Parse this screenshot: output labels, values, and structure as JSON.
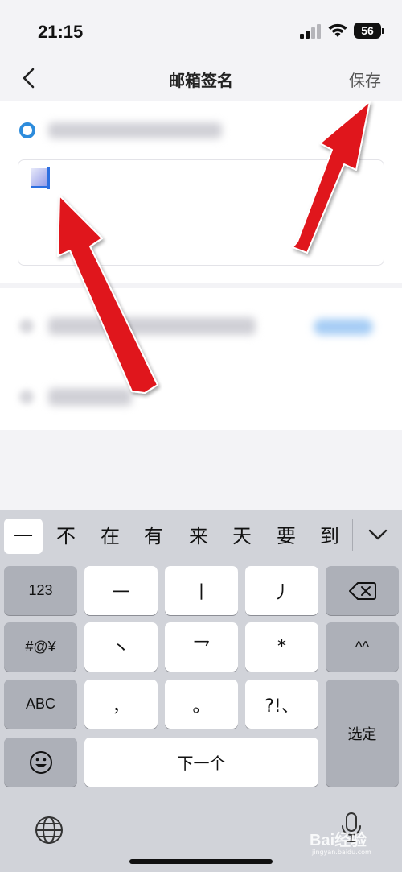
{
  "status_bar": {
    "time": "21:15",
    "battery": "56"
  },
  "nav": {
    "title": "邮箱签名",
    "save_label": "保存"
  },
  "keyboard": {
    "candidates": [
      "一",
      "不",
      "在",
      "有",
      "来",
      "天",
      "要",
      "到"
    ],
    "keys": {
      "num": "123",
      "sym": "#@¥",
      "abc": "ABC",
      "heng": "一",
      "shu": "丨",
      "pie": "丿",
      "dian": "丶",
      "zhe": "乛",
      "any": "*",
      "face": "^^",
      "comma": "，",
      "period": "。",
      "punct": "?!、",
      "next": "下一个",
      "confirm": "选定"
    }
  },
  "watermark": {
    "brand": "Bai经验",
    "sub": "jingyan.baidu.com"
  },
  "colors": {
    "accent": "#2d8cdc",
    "arrow": "#e0161d",
    "keyboard_bg": "#d1d3d9"
  }
}
